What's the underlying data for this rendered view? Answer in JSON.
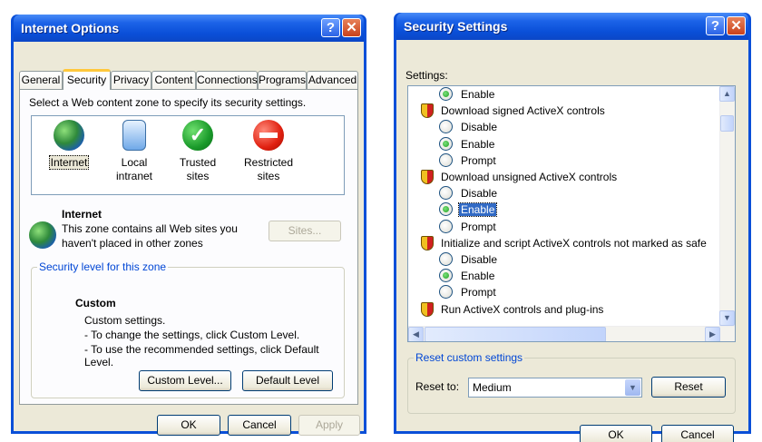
{
  "internet_options": {
    "title": "Internet Options",
    "tabs": [
      "General",
      "Security",
      "Privacy",
      "Content",
      "Connections",
      "Programs",
      "Advanced"
    ],
    "active_tab": "Security",
    "zone_prompt": "Select a Web content zone to specify its security settings.",
    "zones": [
      {
        "label_line1": "Internet",
        "label_line2": "",
        "icon": "globe-icon"
      },
      {
        "label_line1": "Local intranet",
        "label_line2": "",
        "icon": "intranet-icon"
      },
      {
        "label_line1": "Trusted sites",
        "label_line2": "",
        "icon": "checkmark-icon"
      },
      {
        "label_line1": "Restricted",
        "label_line2": "sites",
        "icon": "restricted-icon"
      }
    ],
    "zone_info": {
      "name": "Internet",
      "desc_line1": "This zone contains all Web sites you",
      "desc_line2": "haven't placed in other zones",
      "sites_button": "Sites..."
    },
    "security_level": {
      "group_label": "Security level for this zone",
      "level": "Custom",
      "line1": "Custom settings.",
      "line2": "- To change the settings, click Custom Level.",
      "line3": "- To use the recommended settings, click Default Level.",
      "custom_level_button": "Custom Level...",
      "default_level_button": "Default Level"
    },
    "buttons": {
      "ok": "OK",
      "cancel": "Cancel",
      "apply": "Apply"
    }
  },
  "security_settings": {
    "title": "Security Settings",
    "settings_label": "Settings:",
    "items": [
      {
        "kind": "option",
        "label": "Enable",
        "selected": true
      },
      {
        "kind": "heading",
        "label": "Download signed ActiveX controls"
      },
      {
        "kind": "option",
        "label": "Disable",
        "selected": false
      },
      {
        "kind": "option",
        "label": "Enable",
        "selected": true
      },
      {
        "kind": "option",
        "label": "Prompt",
        "selected": false
      },
      {
        "kind": "heading",
        "label": "Download unsigned ActiveX controls"
      },
      {
        "kind": "option",
        "label": "Disable",
        "selected": false
      },
      {
        "kind": "option",
        "label": "Enable",
        "selected": true,
        "highlighted": true
      },
      {
        "kind": "option",
        "label": "Prompt",
        "selected": false
      },
      {
        "kind": "heading",
        "label": "Initialize and script ActiveX controls not marked as safe"
      },
      {
        "kind": "option",
        "label": "Disable",
        "selected": false
      },
      {
        "kind": "option",
        "label": "Enable",
        "selected": true
      },
      {
        "kind": "option",
        "label": "Prompt",
        "selected": false
      },
      {
        "kind": "heading",
        "label": "Run ActiveX controls and plug-ins"
      }
    ],
    "reset": {
      "group_label": "Reset custom settings",
      "reset_to_label": "Reset to:",
      "reset_to_value": "Medium",
      "reset_button": "Reset"
    },
    "buttons": {
      "ok": "OK",
      "cancel": "Cancel"
    },
    "highlight_color": "#316ac5"
  }
}
